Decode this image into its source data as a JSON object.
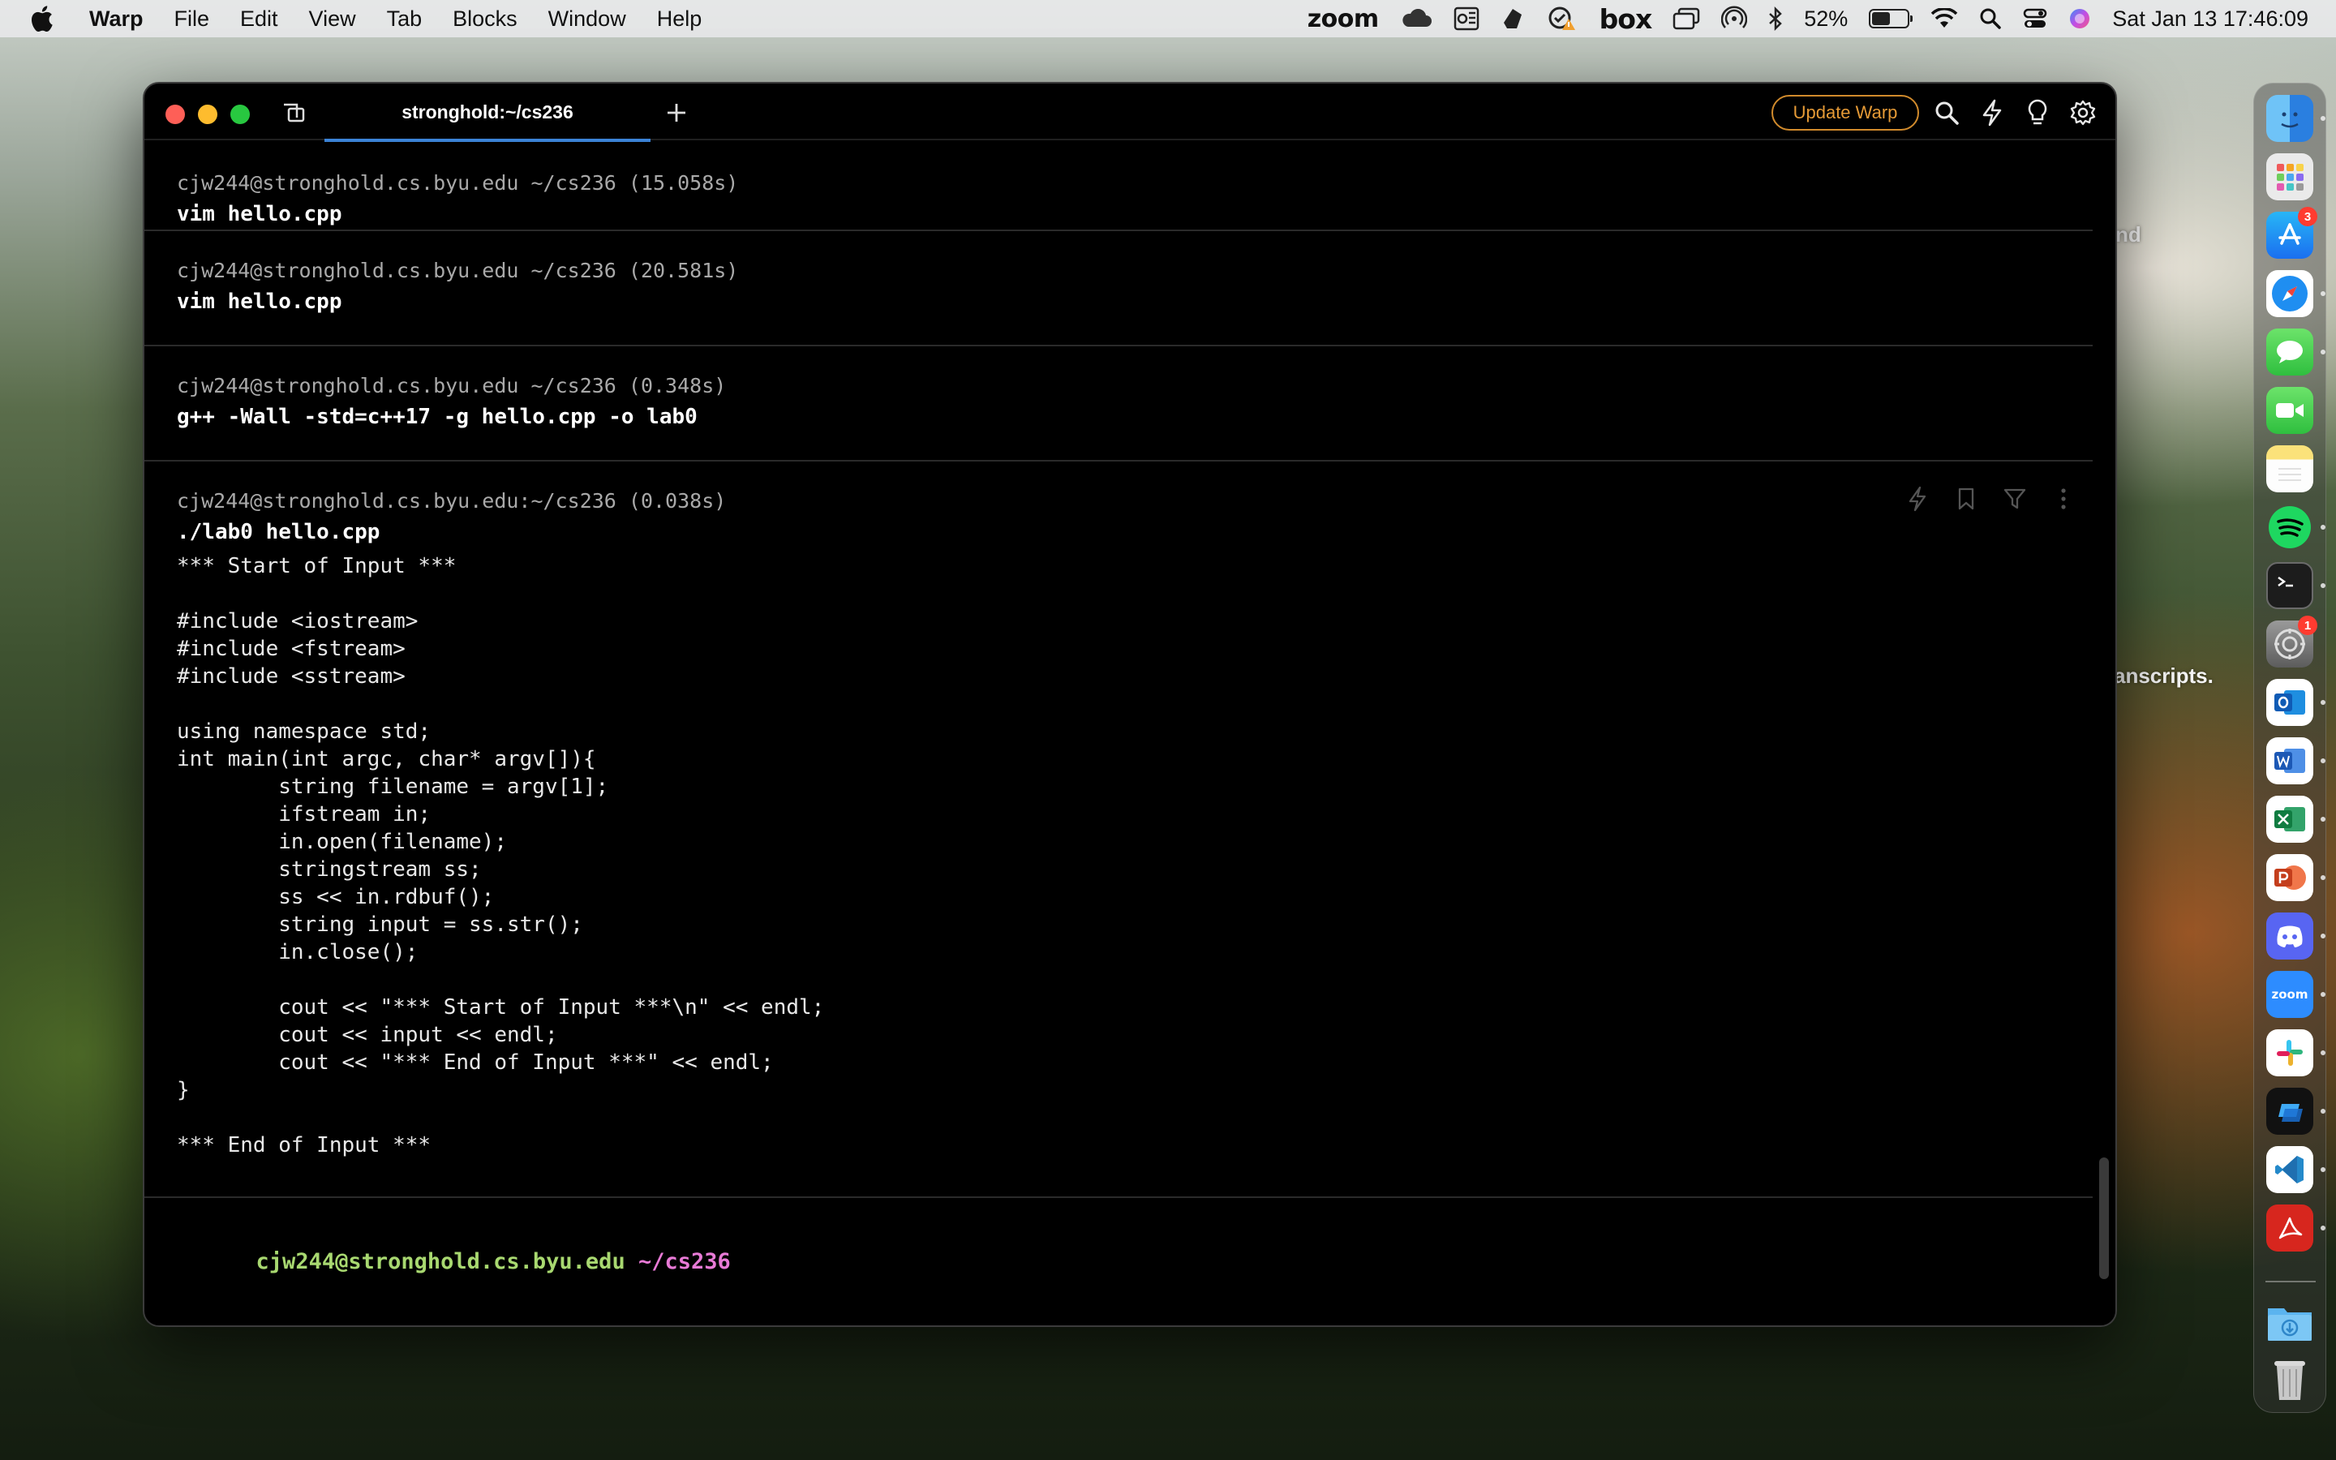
{
  "menubar": {
    "app_name": "Warp",
    "items": [
      "File",
      "Edit",
      "View",
      "Tab",
      "Blocks",
      "Window",
      "Help"
    ],
    "status": {
      "zoom": "zoom",
      "box": "box",
      "battery_percent": "52%",
      "battery_level": 0.52,
      "datetime": "Sat Jan 13  17:46:09"
    }
  },
  "background_fragments": {
    "top_right": "nd",
    "middle_right": "anscripts."
  },
  "window": {
    "tab_title": "stronghold:~/cs236",
    "update_button": "Update Warp"
  },
  "terminal": {
    "blocks": [
      {
        "meta": "cjw244@stronghold.cs.byu.edu ~/cs236 (15.058s)",
        "command": "vim hello.cpp"
      },
      {
        "meta": "cjw244@stronghold.cs.byu.edu ~/cs236 (20.581s)",
        "command": "vim hello.cpp"
      },
      {
        "meta": "cjw244@stronghold.cs.byu.edu ~/cs236 (0.348s)",
        "command": "g++ -Wall -std=c++17 -g hello.cpp -o lab0"
      },
      {
        "meta": "cjw244@stronghold.cs.byu.edu:~/cs236 (0.038s)",
        "command": "./lab0 hello.cpp"
      }
    ],
    "output_lines": [
      "*** Start of Input ***",
      "",
      "#include <iostream>",
      "#include <fstream>",
      "#include <sstream>",
      "",
      "using namespace std;",
      "int main(int argc, char* argv[]){",
      "        string filename = argv[1];",
      "        ifstream in;",
      "        in.open(filename);",
      "        stringstream ss;",
      "        ss << in.rdbuf();",
      "        string input = ss.str();",
      "        in.close();",
      "",
      "        cout << \"*** Start of Input ***\\n\" << endl;",
      "        cout << input << endl;",
      "        cout << \"*** End of Input ***\" << endl;",
      "}",
      "",
      "*** End of Input ***"
    ],
    "prompt_host": "cjw244@stronghold.cs.byu.edu",
    "prompt_path": "~/cs236"
  },
  "dock": {
    "app_store_badge": "3",
    "settings_badge": "1",
    "zoom_label": "zoom"
  },
  "colors": {
    "update_accent": "#e59a36",
    "tab_underline": "#3b82d6",
    "prompt_host": "#a8d870",
    "prompt_path": "#e87ad6"
  }
}
